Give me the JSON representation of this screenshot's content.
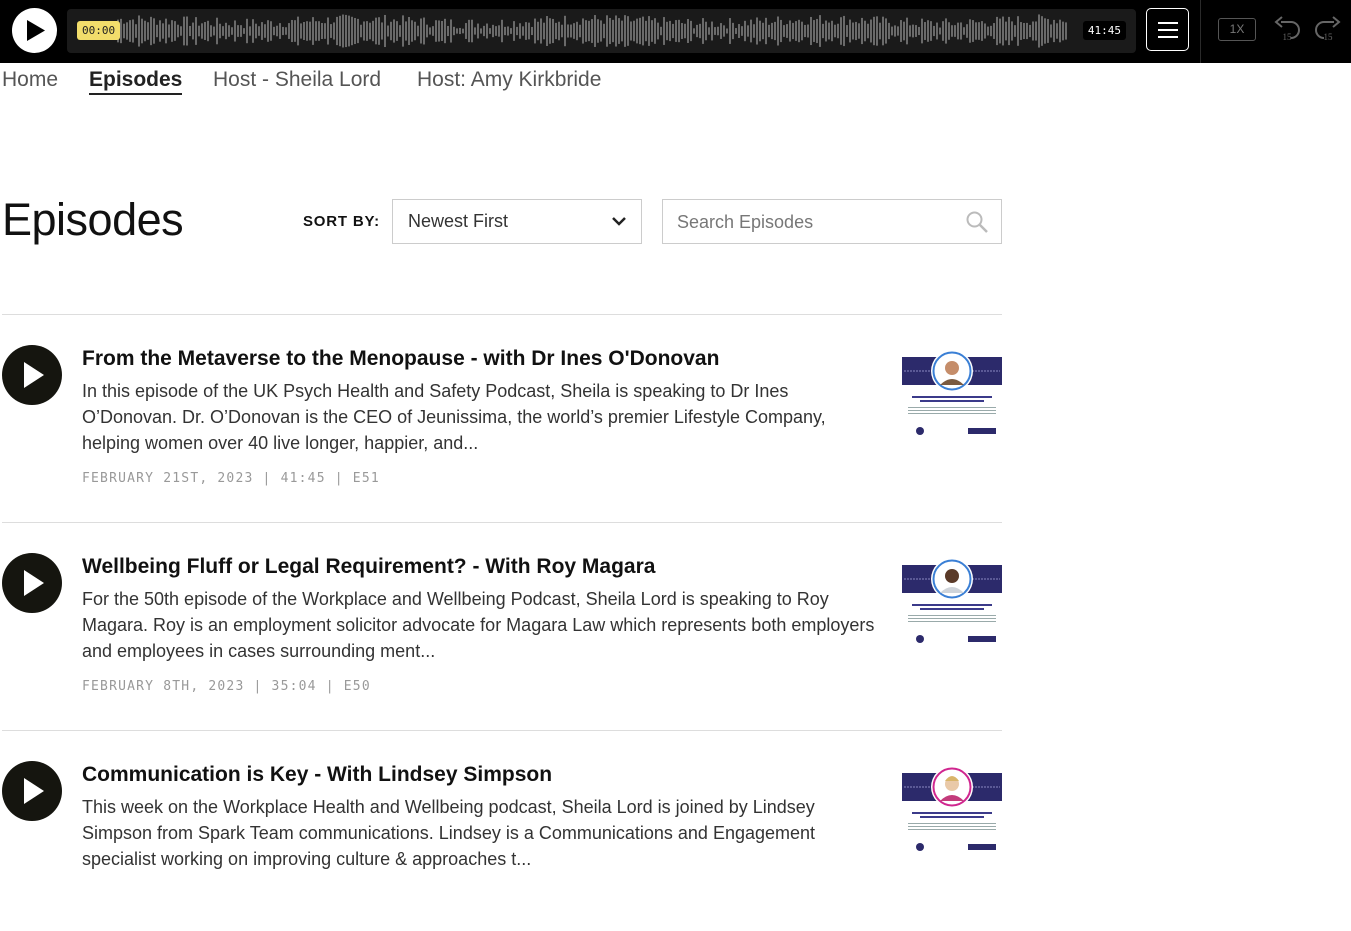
{
  "player": {
    "current_time": "00:00",
    "total_time": "41:45",
    "speed": "1X",
    "skip_back": "15",
    "skip_forward": "15"
  },
  "nav": {
    "items": [
      {
        "label": "Home",
        "active": false
      },
      {
        "label": "Episodes",
        "active": true
      },
      {
        "label": "Host - Sheila Lord",
        "active": false
      },
      {
        "label": "Host: Amy Kirkbride",
        "active": false
      }
    ]
  },
  "page": {
    "title": "Episodes",
    "sort_label": "SORT BY:",
    "sort_value": "Newest First",
    "search_placeholder": "Search Episodes"
  },
  "episodes": [
    {
      "title": "From the Metaverse to the Menopause - with Dr Ines O'Donovan",
      "description": "In this episode of the UK Psych Health and Safety Podcast, Sheila is speaking to Dr Ines O’Donovan. Dr. O’Donovan is the CEO of Jeunissima, the world’s premier Lifestyle Company, helping women over 40 live longer, happier, and...",
      "meta": "FEBRUARY 21ST, 2023 | 41:45 | E51",
      "thumb_title": "THE UK PSYCH HEALTH & SAFETY PODCAST",
      "thumb_ring": "#3a7fd5"
    },
    {
      "title": "Wellbeing Fluff or Legal Requirement? - With Roy Magara",
      "description": "For the 50th episode of the Workplace and Wellbeing Podcast, Sheila Lord is speaking to Roy Magara. Roy is an employment solicitor advocate for Magara Law which represents both employers and employees in cases surrounding ment...",
      "meta": "FEBRUARY 8TH, 2023 | 35:04 | E50",
      "thumb_title": "THE UK PSYCH HEALTH AND SAFETY PODCAST",
      "thumb_ring": "#3a7fd5"
    },
    {
      "title": "Communication is Key - With Lindsey Simpson",
      "description": "This week on the Workplace Health and Wellbeing podcast, Sheila Lord is joined by Lindsey Simpson from Spark Team communications. Lindsey is a Communications and Engagement specialist working on improving culture & approaches t...",
      "meta": "",
      "thumb_title": "THE WORKPLACE HEALTH & WELLBEING PODCAST",
      "thumb_ring": "#d0268f"
    }
  ],
  "colors": {
    "player_bg": "#000000",
    "time_badge": "#f2dd6b",
    "thumb_band": "#2c2a6b",
    "play_button": "#15150f"
  }
}
